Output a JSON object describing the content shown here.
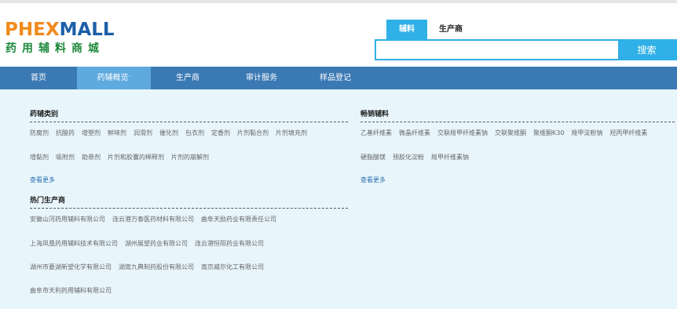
{
  "logo": {
    "main_orange": "PHEX",
    "main_blue": "MALL",
    "sub": "药用辅料商城"
  },
  "search": {
    "tabs": [
      "辅料",
      "生产商"
    ],
    "active_tab": "辅料",
    "placeholder": "",
    "button_label": "搜索"
  },
  "nav": {
    "items": [
      "首页",
      "药辅概览",
      "生产商",
      "审计服务",
      "样品登记"
    ],
    "active": "药辅概览"
  },
  "categories": {
    "title": "药辅类别",
    "row1": [
      "防腐剂",
      "抗酸药",
      "增塑剂",
      "鲜味剂",
      "润滑剂",
      "催化剂",
      "包衣剂",
      "定香剂",
      "片剂黏合剂",
      "片剂填充剂"
    ],
    "row2": [
      "增黏剂",
      "吸附剂",
      "助悬剂",
      "片剂和胶囊的稀释剂",
      "片剂的崩解剂"
    ],
    "more": "查看更多"
  },
  "bestsellers": {
    "title": "畅销辅料",
    "row1": [
      "乙基纤维素",
      "微晶纤维素",
      "交联羧甲纤维素钠",
      "交联聚维酮",
      "聚维酮K30",
      "羧甲淀粉钠",
      "羟丙甲纤维素"
    ],
    "row2": [
      "硬脂酸镁",
      "预胶化淀粉",
      "羧甲纤维素钠"
    ],
    "more": "查看更多"
  },
  "manufacturers": {
    "title": "热门生产商",
    "rows": [
      [
        "安徽山河药用辅料有限公司",
        "连云港万泰医药材料有限公司",
        "曲阜天励药业有限责任公司"
      ],
      [
        "上海凤凰药用辅料技术有限公司",
        "湖州展望药业有限公司",
        "连云港恒阳药业有限公司"
      ],
      [
        "湖州市菱湖新望化学有限公司",
        "湖南九典制药股份有限公司",
        "南京威尔化工有限公司"
      ],
      [
        "曲阜市天利药用辅料有限公司"
      ]
    ]
  },
  "colors": {
    "accent": "#2fb0e6",
    "nav_bg": "#3b79b4",
    "nav_active": "#5ea9de",
    "content_bg": "#e8f6fc",
    "logo_orange": "#f08a1c",
    "logo_blue": "#1d5fa8",
    "logo_green": "#1e8a3c"
  }
}
